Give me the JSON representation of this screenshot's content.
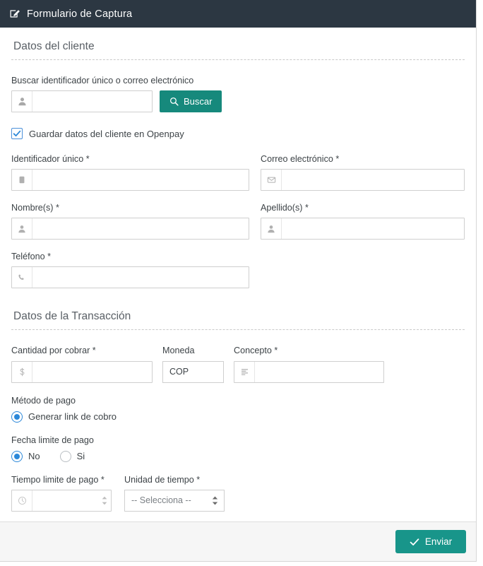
{
  "window": {
    "header_title": "Formulario de Captura",
    "header_icon": "edit-square-icon",
    "header_bg": "#2c3742"
  },
  "colors": {
    "accent_teal": "#16897c",
    "submit_teal": "#18958a",
    "radio_blue": "#2c88d9",
    "checkbox_blue": "#4a90d9",
    "border_grey": "#cfcfcf"
  },
  "sections": {
    "customer": {
      "title": "Datos del cliente",
      "search": {
        "label": "Buscar identificador único o correo electrónico",
        "input_value": "",
        "input_placeholder": "",
        "icon": "user-icon",
        "button_label": "Buscar",
        "button_icon": "search-icon"
      },
      "save_checkbox": {
        "label": "Guardar datos del cliente en Openpay",
        "checked": true
      },
      "fields": {
        "unique_id": {
          "label": "Identificador único *",
          "value": "",
          "placeholder": "",
          "icon": "id-card-icon"
        },
        "email": {
          "label": "Correo electrónico *",
          "value": "",
          "placeholder": "",
          "icon": "envelope-icon"
        },
        "first_name": {
          "label": "Nombre(s) *",
          "value": "",
          "placeholder": "",
          "icon": "user-icon"
        },
        "last_name": {
          "label": "Apellido(s) *",
          "value": "",
          "placeholder": "",
          "icon": "user-icon"
        },
        "phone": {
          "label": "Teléfono *",
          "value": "",
          "placeholder": "",
          "icon": "phone-icon"
        }
      }
    },
    "transaction": {
      "title": "Datos de la Transacción",
      "amount": {
        "label": "Cantidad por cobrar *",
        "value": "",
        "placeholder": "",
        "icon": "dollar-icon"
      },
      "currency": {
        "label": "Moneda",
        "value": "COP"
      },
      "concept": {
        "label": "Concepto *",
        "value": "",
        "placeholder": "",
        "icon": "align-left-icon"
      },
      "payment_method": {
        "label": "Método de pago",
        "options": [
          {
            "label": "Generar link de cobro",
            "selected": true
          }
        ]
      },
      "due_date": {
        "label": "Fecha limite de pago",
        "options": [
          {
            "label": "No",
            "selected": true
          },
          {
            "label": "Si",
            "selected": false
          }
        ]
      },
      "time_limit": {
        "label": "Tiempo limite de pago *",
        "value": "",
        "placeholder": "",
        "icon": "clock-icon"
      },
      "time_unit": {
        "label": "Unidad de tiempo *",
        "selected": "-- Selecciona --"
      }
    }
  },
  "footer": {
    "submit_label": "Enviar",
    "submit_icon": "check-icon"
  }
}
